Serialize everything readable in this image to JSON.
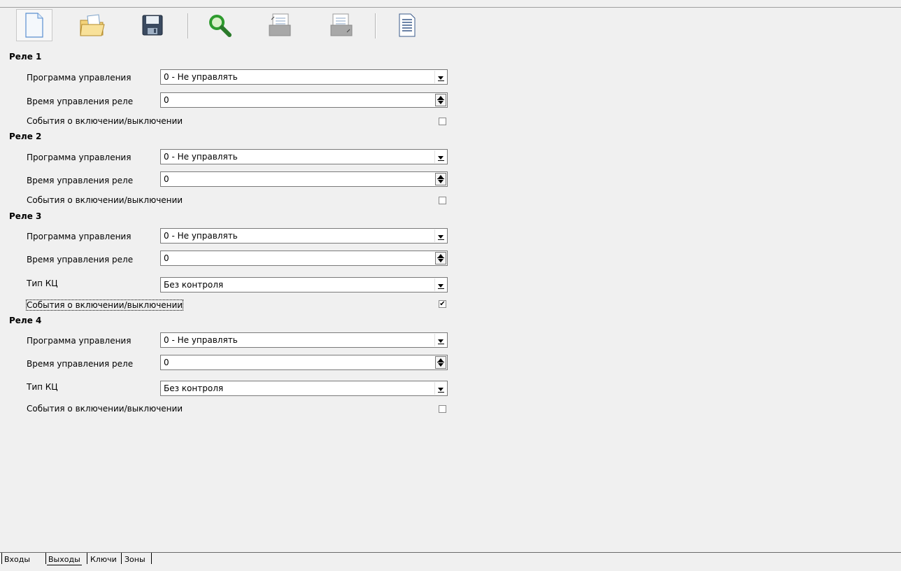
{
  "toolbar": {
    "buttons": [
      {
        "name": "new-file-icon"
      },
      {
        "name": "open-folder-icon"
      },
      {
        "name": "save-disk-icon"
      },
      {
        "name": "search-icon"
      },
      {
        "name": "upload-config-icon"
      },
      {
        "name": "download-config-icon"
      },
      {
        "name": "report-document-icon"
      }
    ]
  },
  "labels": {
    "program": "Программа управления",
    "time": "Время управления реле",
    "events": "События о включении/выключении",
    "kc_type": "Тип КЦ"
  },
  "relays": [
    {
      "title": "Реле 1",
      "program": "0 - Не управлять",
      "time": "0",
      "events_checked": false
    },
    {
      "title": "Реле 2",
      "program": "0 - Не управлять",
      "time": "0",
      "events_checked": false
    },
    {
      "title": "Реле 3",
      "program": "0 - Не управлять",
      "time": "0",
      "kc_type": "Без контроля",
      "events_checked": true
    },
    {
      "title": "Реле 4",
      "program": "0 - Не управлять",
      "time": "0",
      "kc_type": "Без контроля",
      "events_checked": false
    }
  ],
  "tabs": [
    "Входы",
    "Выходы",
    "Ключи",
    "Зоны"
  ],
  "active_tab": "Выходы"
}
